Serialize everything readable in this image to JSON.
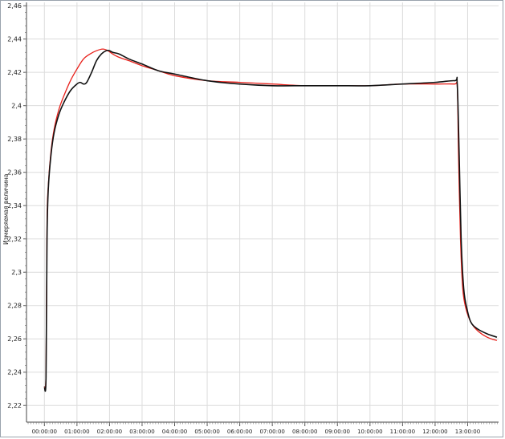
{
  "chart_data": {
    "type": "line",
    "ylabel": "Измеряемая величина",
    "xlabel": "",
    "ylim": [
      2.21,
      2.462
    ],
    "xlim": [
      -0.55,
      13.95
    ],
    "grid": true,
    "legend": "none",
    "y_ticks": [
      "2,22",
      "2,24",
      "2,26",
      "2,28",
      "2,3",
      "2,32",
      "2,34",
      "2,36",
      "2,38",
      "2,4",
      "2,42",
      "2,44",
      "2,46"
    ],
    "x_ticks": [
      "00:00:00",
      "01:00:00",
      "02:00:00",
      "03:00:00",
      "04:00:00",
      "05:00:00",
      "06:00:00",
      "07:00:00",
      "08:00:00",
      "09:00:00",
      "10:00:00",
      "11:00:00",
      "12:00:00",
      "13:00:00"
    ],
    "series": [
      {
        "color": "#e8201a",
        "x": [
          0,
          0.05,
          0.08,
          0.12,
          0.2,
          0.3,
          0.45,
          0.6,
          0.8,
          1.0,
          1.2,
          1.4,
          1.6,
          1.8,
          1.95,
          2.1,
          2.3,
          2.6,
          3.0,
          3.5,
          4.0,
          5.0,
          6.0,
          7.0,
          8.0,
          9.0,
          10.0,
          11.0,
          12.0,
          12.6,
          12.68,
          12.72,
          12.78,
          12.85,
          12.95,
          13.1,
          13.3,
          13.6,
          13.9
        ],
        "y": [
          2.231,
          2.24,
          2.328,
          2.352,
          2.372,
          2.386,
          2.398,
          2.406,
          2.415,
          2.422,
          2.428,
          2.431,
          2.433,
          2.434,
          2.433,
          2.431,
          2.429,
          2.427,
          2.424,
          2.421,
          2.418,
          2.415,
          2.414,
          2.413,
          2.412,
          2.412,
          2.412,
          2.413,
          2.413,
          2.413,
          2.412,
          2.37,
          2.32,
          2.29,
          2.278,
          2.27,
          2.265,
          2.261,
          2.259
        ]
      },
      {
        "color": "#111111",
        "x": [
          0,
          0.05,
          0.08,
          0.12,
          0.2,
          0.3,
          0.45,
          0.6,
          0.8,
          1.0,
          1.1,
          1.2,
          1.3,
          1.45,
          1.6,
          1.75,
          1.9,
          2.0,
          2.1,
          2.3,
          2.6,
          3.0,
          3.5,
          4.0,
          5.0,
          6.0,
          7.0,
          8.0,
          9.0,
          10.0,
          11.0,
          12.0,
          12.6,
          12.68,
          12.74,
          12.8,
          12.88,
          12.98,
          13.1,
          13.3,
          13.6,
          13.9
        ],
        "y": [
          2.231,
          2.237,
          2.32,
          2.35,
          2.37,
          2.384,
          2.395,
          2.402,
          2.409,
          2.413,
          2.414,
          2.413,
          2.414,
          2.42,
          2.427,
          2.431,
          2.433,
          2.433,
          2.432,
          2.431,
          2.428,
          2.425,
          2.421,
          2.419,
          2.415,
          2.413,
          2.412,
          2.412,
          2.412,
          2.412,
          2.413,
          2.414,
          2.415,
          2.413,
          2.37,
          2.32,
          2.29,
          2.278,
          2.27,
          2.266,
          2.263,
          2.261
        ]
      }
    ]
  }
}
